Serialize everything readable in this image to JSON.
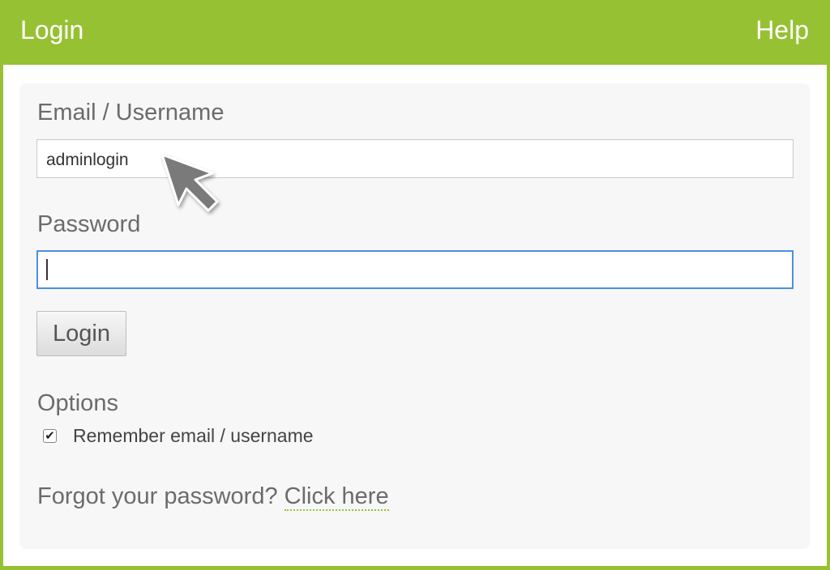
{
  "header": {
    "title": "Login",
    "help_label": "Help",
    "accent_color": "#96c132"
  },
  "form": {
    "email_label": "Email / Username",
    "email_value": "adminlogin",
    "password_label": "Password",
    "password_value": "",
    "login_button": "Login",
    "options_label": "Options",
    "remember_label": "Remember email / username",
    "remember_checked": true,
    "forgot_text": "Forgot your password?",
    "forgot_link": "Click here"
  },
  "icons": {
    "checkmark": "✔"
  }
}
